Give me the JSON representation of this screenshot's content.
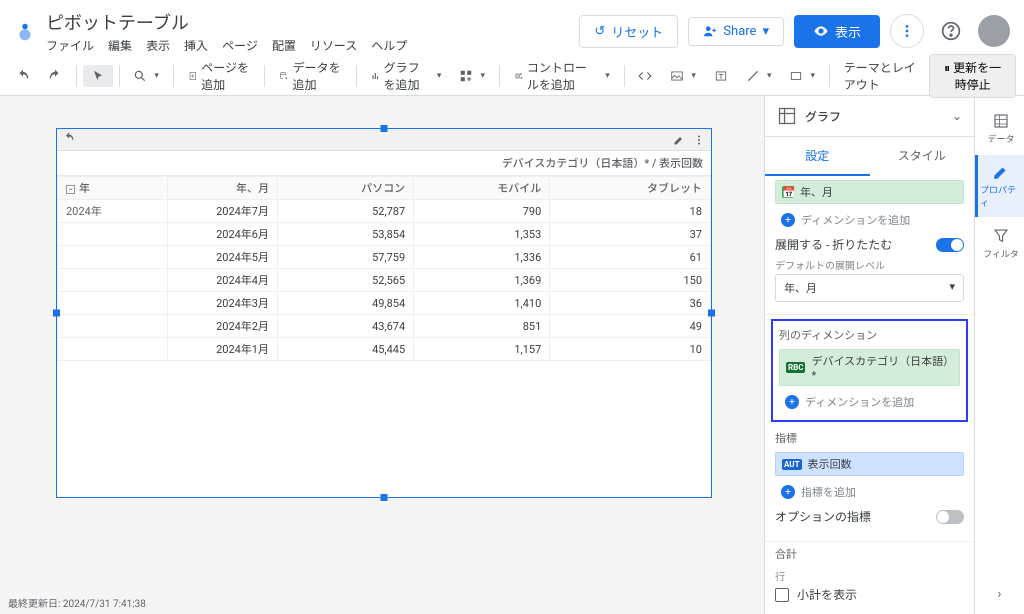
{
  "header": {
    "title": "ピボットテーブル",
    "menu": [
      "ファイル",
      "編集",
      "表示",
      "挿入",
      "ページ",
      "配置",
      "リソース",
      "ヘルプ"
    ],
    "reset": "リセット",
    "share": "Share",
    "view": "表示"
  },
  "toolbar": {
    "addPage": "ページを追加",
    "addData": "データを追加",
    "addChart": "グラフを追加",
    "addControl": "コントロールを追加",
    "themeLayout": "テーマとレイアウト",
    "pauseUpdate": "更新を一時停止"
  },
  "componentToolbar": {},
  "pivotHeader": "デバイスカテゴリ（日本語）* / 表示回数",
  "pivotColumns": {
    "year": "年",
    "yearMonth": "年、月",
    "col1": "パソコン",
    "col2": "モバイル",
    "col3": "タブレット"
  },
  "pivotRows": [
    {
      "year": "2024年",
      "ym": "2024年7月",
      "c1": "52,787",
      "c2": "790",
      "c3": "18"
    },
    {
      "year": "",
      "ym": "2024年6月",
      "c1": "53,854",
      "c2": "1,353",
      "c3": "37"
    },
    {
      "year": "",
      "ym": "2024年5月",
      "c1": "57,759",
      "c2": "1,336",
      "c3": "61"
    },
    {
      "year": "",
      "ym": "2024年4月",
      "c1": "52,565",
      "c2": "1,369",
      "c3": "150"
    },
    {
      "year": "",
      "ym": "2024年3月",
      "c1": "49,854",
      "c2": "1,410",
      "c3": "36"
    },
    {
      "year": "",
      "ym": "2024年2月",
      "c1": "43,674",
      "c2": "851",
      "c3": "49"
    },
    {
      "year": "",
      "ym": "2024年1月",
      "c1": "45,445",
      "c2": "1,157",
      "c3": "10"
    }
  ],
  "footer": "最終更新日: 2024/7/31 7:41:38",
  "props": {
    "panelTitle": "グラフ",
    "tabs": {
      "setup": "設定",
      "style": "スタイル"
    },
    "rowDim": {
      "chip": "年、月",
      "add": "ディメンションを追加"
    },
    "expand": {
      "label": "展開する - 折りたたむ",
      "defaultLevel": "デフォルトの展開レベル",
      "levelValue": "年、月"
    },
    "colDim": {
      "title": "列のディメンション",
      "chip": "デバイスカテゴリ（日本語）*",
      "add": "ディメンションを追加"
    },
    "metric": {
      "title": "指標",
      "chip": "表示回数",
      "add": "指標を追加"
    },
    "optional": "オプションの指標",
    "total": {
      "title": "合計",
      "rows": "行",
      "showSubtotal": "小計を表示"
    }
  },
  "rail": {
    "data": "データ",
    "properties": "プロパティ",
    "filter": "フィルタ"
  }
}
